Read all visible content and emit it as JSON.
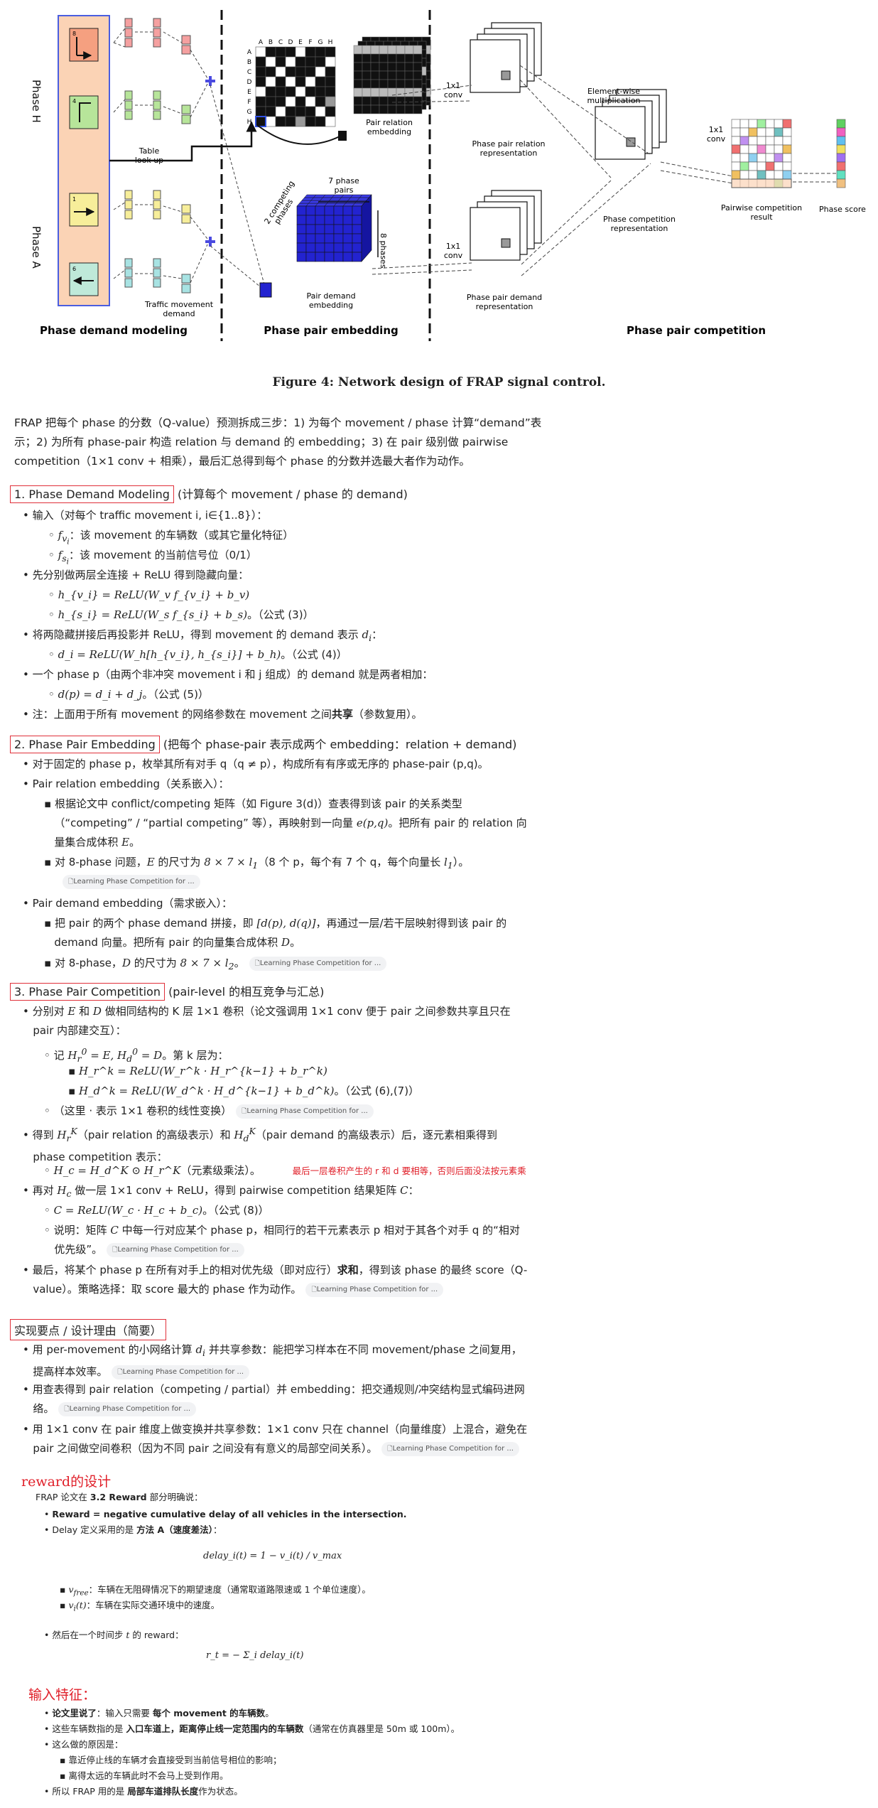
{
  "figure": {
    "labels": {
      "phase_h": "Phase H",
      "phase_a": "Phase A",
      "table_lookup": "Table\nlook up",
      "traffic_movement_demand": "Traffic movement\ndemand",
      "matrix_cols": [
        "A",
        "B",
        "C",
        "D",
        "E",
        "F",
        "G",
        "H"
      ],
      "matrix_rows": [
        "A",
        "B",
        "C",
        "D",
        "E",
        "F",
        "G",
        "H"
      ],
      "pair_relation_embedding": "Pair relation\nembedding",
      "competing_phases": "2 competing\nphases",
      "seven_phase_pairs": "7 phase\npairs",
      "eight_phases": "8\nphases",
      "pair_demand_embedding": "Pair demand\nembedding",
      "conv_1x1_a": "1x1\nconv",
      "conv_1x1_b": "1x1\nconv",
      "conv_1x1_c": "1x1\nconv",
      "phase_pair_relation_rep": "Phase pair relation\nrepresentation",
      "phase_pair_demand_rep": "Phase pair demand\nrepresentation",
      "element_wise_mult": "Element-wise\nmultiplication",
      "phase_competition_rep": "Phase competition\nrepresentation",
      "pairwise_competition_result": "Pairwise competition\nresult",
      "phase_score": "Phase score",
      "sec1": "Phase demand modeling",
      "sec2": "Phase pair embedding",
      "sec3": "Phase pair competition",
      "phase_icons": [
        "8",
        "4",
        "1",
        "6"
      ]
    },
    "colors": {
      "phase_bg": "#fbd3b5",
      "cube_blue": "#2323d0",
      "plus": "#4a4ae0"
    }
  },
  "caption": "Figure 4: Network design of FRAP signal control.",
  "intro": "FRAP 把每个 phase 的分数（Q-value）预测拆成三步：1) 为每个 movement / phase 计算“demand”表示；2) 为所有 phase-pair 构造 relation 与 demand 的 embedding；3) 在 pair 级别做 pairwise competition（1×1 conv + 相乘），最后汇总得到每个 phase 的分数并选最大者作为动作。",
  "chip_text": "Learning Phase Competition for ...",
  "s1": {
    "title": "1.  Phase Demand Modeling",
    "note": "(计算每个 movement / phase 的 demand)",
    "b1": "输入（对每个 traffic movement i, i∈{1..8}）：",
    "b1a": "：该 movement 的车辆数（或其它量化特征）",
    "b1b": "：该 movement 的当前信号位（0/1）",
    "b2": "先分别做两层全连接 + ReLU 得到隐藏向量：",
    "eq1": "h_{v_i} = ReLU(W_v f_{v_i} + b_v)",
    "eq2": "h_{s_i} = ReLU(W_s f_{s_i} + b_s)",
    "eq2_note": "。（公式 (3)）",
    "b3": "将两隐藏拼接后再投影并 ReLU，得到 movement 的 demand 表示 ",
    "eq3": "d_i = ReLU(W_h[h_{v_i}, h_{s_i}] + b_h)",
    "eq3_note": "。（公式 (4)）",
    "b4": "一个 phase p（由两个非冲突 movement i 和 j 组成）的 demand 就是两者相加：",
    "eq4": "d(p) = d_i + d_j",
    "eq4_note": "。（公式 (5)）",
    "b5a": "注：上面用于所有 movement 的网络参数在 movement 之间",
    "b5b": "共享",
    "b5c": "（参数复用）。"
  },
  "s2": {
    "title": "2.  Phase Pair Embedding",
    "note": "(把每个 phase-pair 表示成两个 embedding：relation + demand)",
    "b1": "对于固定的 phase p，枚举其所有对手 q（q ≠ p），构成所有有序或无序的 phase-pair (p,q)。",
    "b2": "Pair relation embedding（关系嵌入）：",
    "b2a_1": "根据论文中 conflict/competing 矩阵（如 Figure 3(d)）查表得到该 pair 的关系类型",
    "b2a_2": "（“competing” / “partial competing” 等），再映射到一向量 ",
    "b2a_2b": "。把所有 pair 的 relation 向",
    "b2a_3": "量集合成体积 ",
    "b2b_1": "对 8-phase 问题，",
    "b2b_2": " 的尺寸为 ",
    "b2b_3": "（8 个 p，每个有 7 个 q，每个向量长 ",
    "b2b_4": "）。",
    "b3": "Pair demand embedding（需求嵌入）：",
    "b3a_1": "把 pair 的两个 phase demand 拼接，即 ",
    "b3a_2": "，再通过一层/若干层映射得到该 pair 的",
    "b3a_3": "demand 向量。把所有 pair 的向量集合成体积 ",
    "b3b_1": "对 8-phase，",
    "b3b_2": " 的尺寸为 "
  },
  "s3": {
    "title": "3.  Phase Pair Competition",
    "note": "(pair-level 的相互竞争与汇总)",
    "b1_1": "分别对 ",
    "b1_2": " 和 ",
    "b1_3": " 做相同结构的 K 层 1×1 卷积（论文强调用 1×1 conv 便于 pair 之间参数共享且只在",
    "b1_4": "pair 内部建交互）：",
    "b1a_1": "记 ",
    "b1a_2": "。第 k 层为：",
    "eq_hr": "H_r^k = ReLU(W_r^k · H_r^{k−1} + b_r^k)",
    "eq_hd": "H_d^k = ReLU(W_d^k · H_d^{k−1} + b_d^k)",
    "eq_hd_note": "。（公式 (6),(7)）",
    "b1b": "（这里 · 表示 1×1 卷积的线性变换）",
    "b2_1": "得到 ",
    "b2_2": "（pair relation 的高级表示）和 ",
    "b2_3": "（pair demand 的高级表示）后，逐元素相乘得到",
    "b2_4": "phase competition 表示：",
    "eq_hc": "H_c = H_d^K ⊙ H_r^K",
    "eq_hc_note": "（元素级乘法）。",
    "red": "最后一层卷积产生的 r 和 d 要相等，否则后面没法按元素乘",
    "b3_1": "再对 ",
    "b3_2": " 做一层 1×1 conv + ReLU，得到 pairwise competition 结果矩阵 ",
    "eq_c": "C = ReLU(W_c · H_c + b_c)",
    "eq_c_note": "。（公式 (8)）",
    "b3a_1": "说明：矩阵 ",
    "b3a_2": " 中每一行对应某个 phase p，相同行的若干元素表示 p 相对于其各个对手 q 的“相对",
    "b3a_3": "优先级”。",
    "b4_1": "最后，将某个 phase p 在所有对手上的相对优先级（即对应行）",
    "b4_2": "求和",
    "b4_3": "，得到该 phase 的最终 score（Q-",
    "b4_4": "value）。策略选择：取 score 最大的 phase 作为动作。"
  },
  "s4": {
    "title": "实现要点 / 设计理由（简要）",
    "b1_1": "用 per-movement 的小网络计算 ",
    "b1_2": " 并共享参数：能把学习样本在不同 movement/phase 之间复用，",
    "b1_3": "提高样本效率。",
    "b2_1": "用查表得到 pair relation（competing / partial）并 embedding：把交通规则/冲突结构显式编码进网",
    "b2_2": "络。",
    "b3_1": "用 1×1 conv 在 pair 维度上做变换并共享参数：1×1 conv 只在 channel（向量维度）上混合，避免在",
    "b3_2": "pair 之间做空间卷积（因为不同 pair 之间没有有意义的局部空间关系）。"
  },
  "reward": {
    "heading": "reward的设计",
    "intro_1": "FRAP 论文在 ",
    "intro_2": "3.2 Reward",
    "intro_3": " 部分明确说：",
    "b1": "Reward = negative cumulative delay of all vehicles in the intersection.",
    "b2_1": "Delay 定义采用的是 ",
    "b2_2": "方法 A（速度差法）",
    "b2_3": "：",
    "eq_delay": "delay_i(t) = 1 − v_i(t) / v_max",
    "sb1": "：车辆在无阻碍情况下的期望速度（通常取道路限速或 1 个单位速度）。",
    "sb2": "：车辆在实际交通环境中的速度。",
    "b3_1": "然后在一个时间步 ",
    "b3_2": " 的 reward：",
    "eq_r": "r_t = − Σ_i delay_i(t)"
  },
  "features": {
    "heading": "输入特征：",
    "b1_1": "论文里说了",
    "b1_2": "：输入只需要 ",
    "b1_3": "每个 movement 的车辆数",
    "b1_4": "。",
    "b2_1": "这些车辆数指的是 ",
    "b2_2": "入口车道上，距离停止线一定范围内的车辆数",
    "b2_3": "（通常在仿真器里是 50m 或 100m）。",
    "b3": "这么做的原因是：",
    "b3a": "靠近停止线的车辆才会直接受到当前信号相位的影响；",
    "b3b": "离得太远的车辆此时不会马上受到作用。",
    "b4_1": "所以 FRAP 用的是 ",
    "b4_2": "局部车道排队长度",
    "b4_3": "作为状态。"
  }
}
